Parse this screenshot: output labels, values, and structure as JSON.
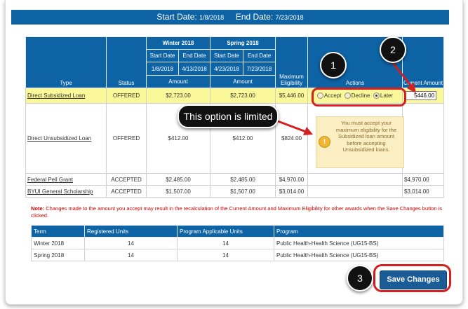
{
  "date_bar": {
    "start_label": "Start Date:",
    "start_value": "1/8/2018",
    "end_label": "End Date:",
    "end_value": "7/23/2018"
  },
  "awards_table": {
    "headers": {
      "type": "Type",
      "status": "Status",
      "winter_term": "Winter 2018",
      "spring_term": "Spring 2018",
      "start_date": "Start Date",
      "end_date": "End Date",
      "winter_start": "1/8/2018",
      "winter_end": "4/13/2018",
      "spring_start": "4/23/2018",
      "spring_end": "7/23/2018",
      "amount": "Amount",
      "max_eligibility": "Maximum Eligibility",
      "actions": "Actions",
      "current_amount": "Current Amount"
    },
    "rows": [
      {
        "type": "Direct Subsidized Loan",
        "status": "OFFERED",
        "winter": "$2,723.00",
        "spring": "$2,723.00",
        "max": "$5,446.00",
        "current": "5446.00"
      },
      {
        "type": "Direct Unsubsidized Loan",
        "status": "OFFERED",
        "winter": "$412.00",
        "spring": "$412.00",
        "max": "$824.00",
        "current": ""
      },
      {
        "type": "Federal Pell Grant",
        "status": "ACCEPTED",
        "winter": "$2,485.00",
        "spring": "$2,485.00",
        "max": "$4,970.00",
        "current": "$4,970.00"
      },
      {
        "type": "BYUI General Scholarship",
        "status": "ACCEPTED",
        "winter": "$1,507.00",
        "spring": "$1,507.00",
        "max": "$3,014.00",
        "current": "$3,014.00"
      }
    ],
    "actions": {
      "accept": "Accept",
      "decline": "Decline",
      "later": "Later",
      "selected": "Later"
    },
    "warning": "You must accept your maximum eligibility for the Subsidized loan amount before accepting Unsubsidized loans."
  },
  "note": {
    "label": "Note:",
    "text": "Changes made to the amount you accept may result in the recalculation of the Current Amount and Maximum Eligibility for other awards when the Save Changes button is clicked."
  },
  "units_table": {
    "headers": [
      "Term",
      "Registered Units",
      "Program Applicable Units",
      "Program"
    ],
    "rows": [
      [
        "Winter 2018",
        "14",
        "14",
        "Public Health-Health Science (UG15-BS)"
      ],
      [
        "Spring 2018",
        "14",
        "14",
        "Public Health-Health Science (UG15-BS)"
      ]
    ]
  },
  "save_button": "Save Changes",
  "annotations": {
    "callout": "This option is limited",
    "badge_1": "1",
    "badge_2": "2",
    "badge_3": "3",
    "accent_color": "#d42020"
  },
  "colors": {
    "header_blue": "#0d63a4",
    "highlight_yellow": "#fbf89a",
    "button_blue": "#1c5c96"
  },
  "icons": {
    "warning": "warning-icon"
  }
}
